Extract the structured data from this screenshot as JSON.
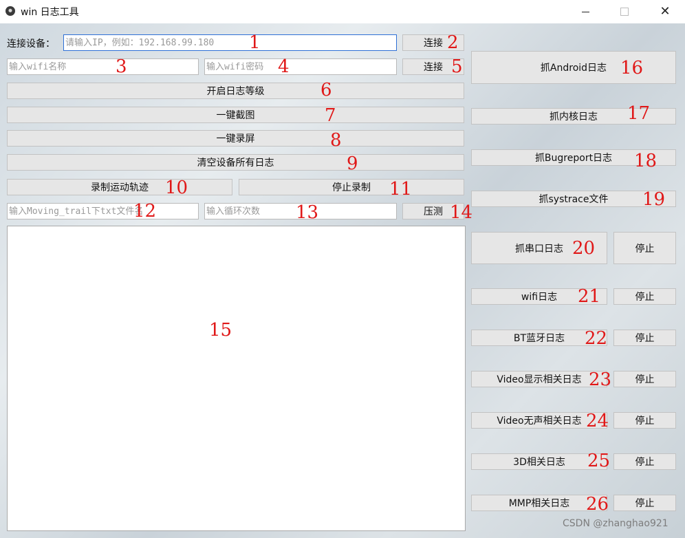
{
  "window": {
    "title": "win 日志工具"
  },
  "connect": {
    "label": "连接设备：",
    "ip_placeholder": "请输入IP，例如：192.168.99.180",
    "connect_label": "连接",
    "wifi_name_placeholder": "输入wifi名称",
    "wifi_password_placeholder": "输入wifi密码",
    "wifi_connect_label": "连接"
  },
  "actions": {
    "log_level": "开启日志等级",
    "screenshot": "一键截图",
    "screen_record": "一键录屏",
    "clear_logs": "清空设备所有日志",
    "record_trail": "录制运动轨迹",
    "stop_record": "停止录制",
    "trail_file_placeholder": "输入Moving_trail下txt文件名",
    "loop_count_placeholder": "输入循环次数",
    "stress_test": "压测"
  },
  "right_panel": {
    "android_log": "抓Android日志",
    "kernel_log": "抓内核日志",
    "bugreport_log": "抓Bugreport日志",
    "systrace_file": "抓systrace文件",
    "serial_log": "抓串口日志",
    "wifi_log": "wifi日志",
    "bt_log": "BT蓝牙日志",
    "video_display_log": "Video显示相关日志",
    "video_silent_log": "Video无声相关日志",
    "3d_log": "3D相关日志",
    "mmp_log": "MMP相关日志",
    "stop_label": "停止"
  },
  "annotations": [
    "1",
    "2",
    "3",
    "4",
    "5",
    "6",
    "7",
    "8",
    "9",
    "10",
    "11",
    "12",
    "13",
    "14",
    "15",
    "16",
    "17",
    "18",
    "19",
    "20",
    "21",
    "22",
    "23",
    "24",
    "25",
    "26"
  ],
  "watermark": "CSDN @zhanghao921"
}
